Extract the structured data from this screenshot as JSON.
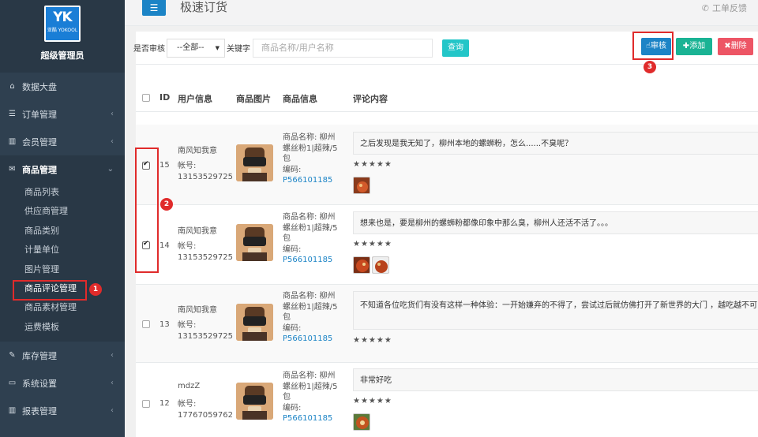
{
  "sidebar": {
    "logo_mark": "YK",
    "logo_text": "亚酷 YOKOOL",
    "role": "超级管理员",
    "nav": [
      {
        "label": "数据大盘",
        "icon": "home-icon"
      },
      {
        "label": "订单管理",
        "icon": "list-icon"
      },
      {
        "label": "会员管理",
        "icon": "bar-chart-icon"
      },
      {
        "label": "商品管理",
        "icon": "envelope-icon"
      },
      {
        "label": "库存管理",
        "icon": "edit-icon"
      },
      {
        "label": "系统设置",
        "icon": "desktop-icon"
      },
      {
        "label": "报表管理",
        "icon": "bar-chart-icon"
      }
    ],
    "sub_items": [
      "商品列表",
      "供应商管理",
      "商品类别",
      "计量单位",
      "图片管理",
      "商品评论管理",
      "商品素材管理",
      "运费模板"
    ]
  },
  "header": {
    "title": "极速订货",
    "feedback": "工单反馈"
  },
  "toolbar": {
    "audit_label": "是否审核",
    "audit_value": "--全部--",
    "keyword_label": "关键字",
    "search_placeholder": "商品名称/用户名称",
    "query": "查询",
    "review": "审核",
    "add": "添加",
    "delete": "删除"
  },
  "table": {
    "headers": [
      "ID",
      "用户信息",
      "商品图片",
      "商品信息",
      "评论内容"
    ],
    "account_prefix": "帐号:",
    "product_prefix": "商品名称:",
    "code_prefix": "编码:",
    "rows": [
      {
        "id": "15",
        "user": "南风知我意",
        "account": "13153529725",
        "product_l1": "柳州",
        "product_l2": "螺丝粉1|超辣/5",
        "product_l3": "包",
        "code": "P566101185",
        "comment": "之后发现是我无知了，柳州本地的螺蛳粉，怎么......不臭呢？",
        "rating": "★★★★★",
        "checked": true
      },
      {
        "id": "14",
        "user": "南风知我意",
        "account": "13153529725",
        "product_l1": "柳州",
        "product_l2": "螺丝粉1|超辣/5",
        "product_l3": "包",
        "code": "P566101185",
        "comment": "想来也是，要是柳州的螺蛳粉都像印象中那么臭，柳州人还活不活了。。。",
        "rating": "★★★★★",
        "checked": true
      },
      {
        "id": "13",
        "user": "南风知我意",
        "account": "13153529725",
        "product_l1": "柳州",
        "product_l2": "螺丝粉1|超辣/5",
        "product_l3": "包",
        "code": "P566101185",
        "comment": "不知道各位吃货们有没有这样一种体验：一开始嫌弃的不得了，尝试过后就仿佛打开了新世界的大门 ，越吃越不可自拔",
        "rating": "★★★★★",
        "checked": false
      },
      {
        "id": "12",
        "user": "mdzZ",
        "account": "17767059762",
        "product_l1": "柳州",
        "product_l2": "螺丝粉1|超辣/5",
        "product_l3": "包",
        "code": "P566101185",
        "comment": "非常好吃",
        "rating": "★★★★★",
        "checked": false
      }
    ]
  },
  "annotations": [
    "1",
    "2",
    "3"
  ],
  "colors": {
    "sidebar_bg": "#2f4050",
    "primary": "#1c84c6",
    "success": "#1ab394",
    "danger": "#ed5565",
    "info": "#23c6c8",
    "highlight": "#e02b2b"
  }
}
